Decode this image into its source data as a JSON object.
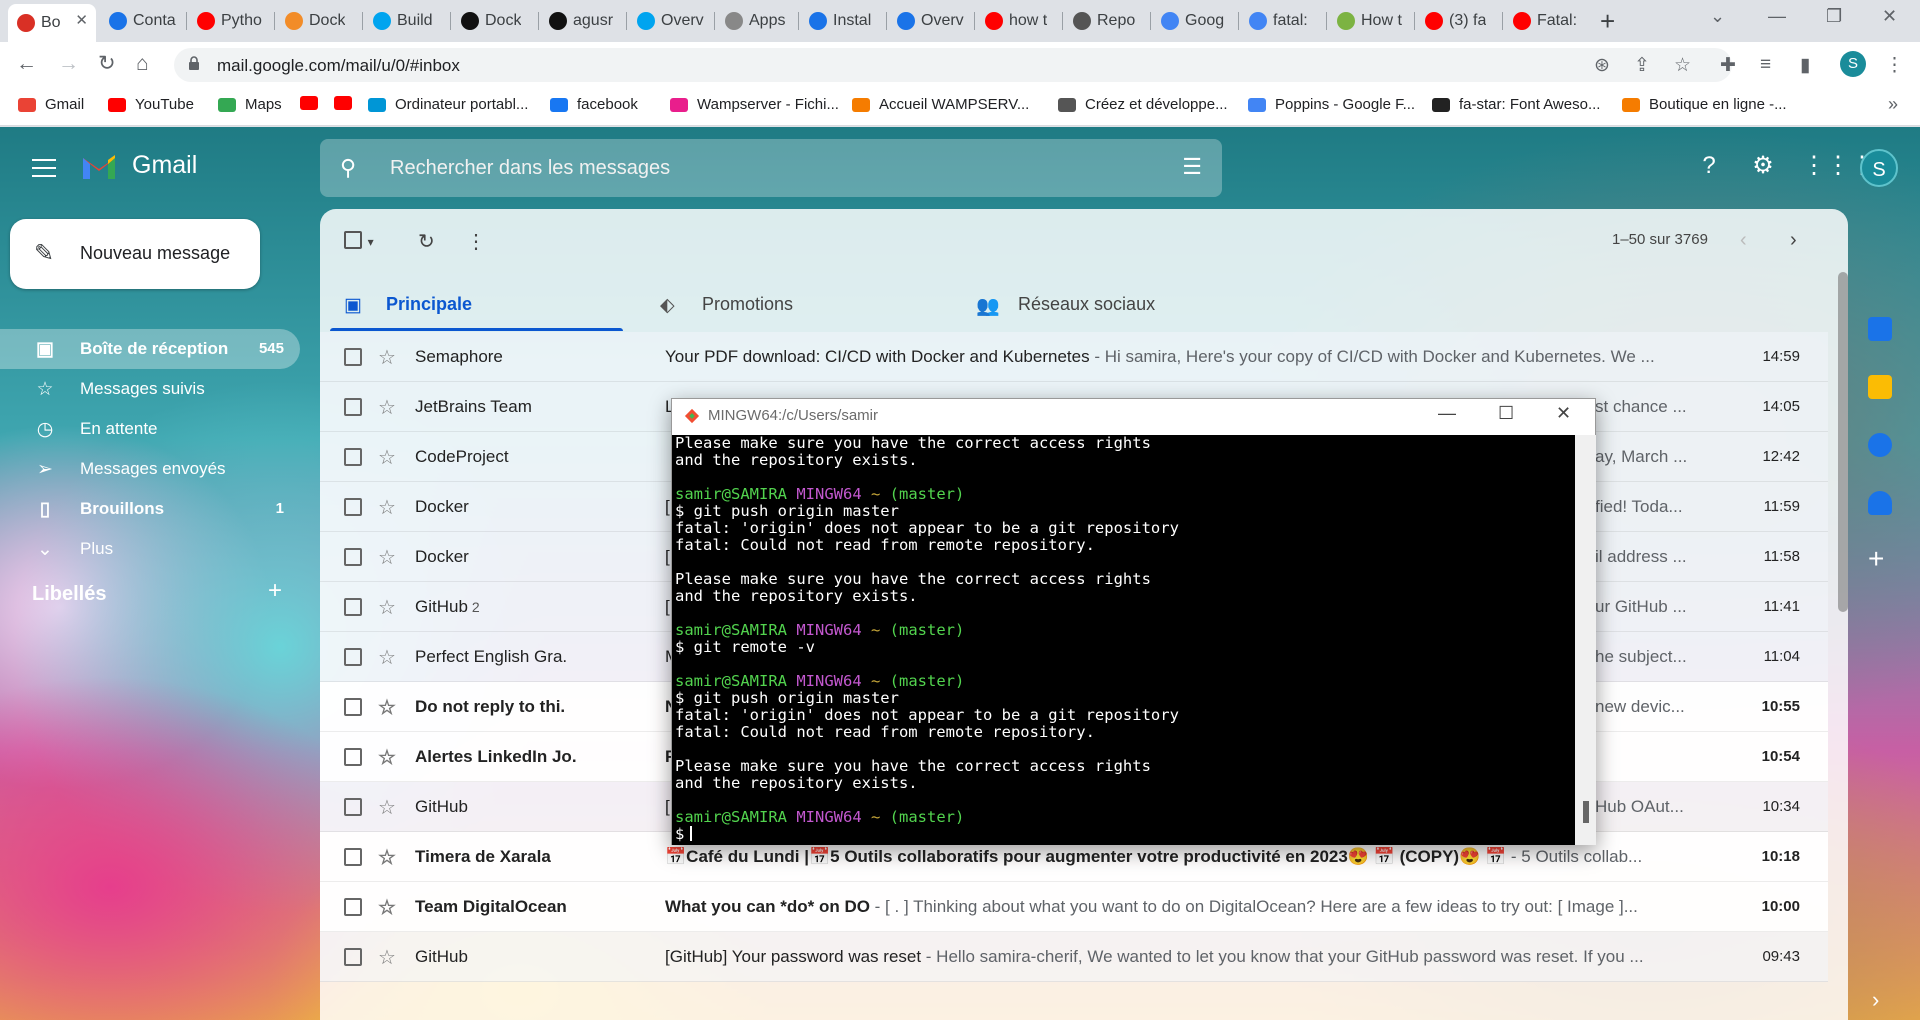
{
  "tabs": [
    {
      "title": "Bo",
      "fav": "#d93025",
      "active": true
    },
    {
      "title": "Conta",
      "fav": "#1a73e8"
    },
    {
      "title": "Pytho",
      "fav": "#ff0000"
    },
    {
      "title": "Dock",
      "fav": "#f28c28"
    },
    {
      "title": "Build",
      "fav": "#00a4ef"
    },
    {
      "title": "Dock",
      "fav": "#111111"
    },
    {
      "title": "agusr",
      "fav": "#111111"
    },
    {
      "title": "Overv",
      "fav": "#00a4ef"
    },
    {
      "title": "Apps",
      "fav": "#888888"
    },
    {
      "title": "Instal",
      "fav": "#1a73e8"
    },
    {
      "title": "Overv",
      "fav": "#1a73e8"
    },
    {
      "title": "how t",
      "fav": "#ff0000"
    },
    {
      "title": "Repo",
      "fav": "#555555"
    },
    {
      "title": "Goog",
      "fav": "#4285f4"
    },
    {
      "title": "fatal:",
      "fav": "#4285f4"
    },
    {
      "title": "How t",
      "fav": "#7cb342"
    },
    {
      "title": "(3) fa",
      "fav": "#ff0000"
    },
    {
      "title": "Fatal:",
      "fav": "#ff0000"
    }
  ],
  "browser": {
    "url": "mail.google.com/mail/u/0/#inbox",
    "profile_initial": "S"
  },
  "bookmarks": [
    {
      "label": "Gmail",
      "color": "#ea4335"
    },
    {
      "label": "YouTube",
      "color": "#ff0000"
    },
    {
      "label": "Maps",
      "color": "#34a853"
    },
    {
      "label": "",
      "color": "#ff0000"
    },
    {
      "label": "",
      "color": "#ff0000"
    },
    {
      "label": "Ordinateur portabl...",
      "color": "#0096d6"
    },
    {
      "label": "facebook",
      "color": "#1877f2"
    },
    {
      "label": "Wampserver - Fichi...",
      "color": "#e91e8c"
    },
    {
      "label": "Accueil WAMPSERV...",
      "color": "#f57c00"
    },
    {
      "label": "Créez et développe...",
      "color": "#555555"
    },
    {
      "label": "Poppins - Google F...",
      "color": "#4285f4"
    },
    {
      "label": "fa-star: Font Aweso...",
      "color": "#222222"
    },
    {
      "label": "Boutique en ligne -...",
      "color": "#f57c00"
    }
  ],
  "gmail": {
    "app_name": "Gmail",
    "search_placeholder": "Rechercher dans les messages",
    "avatar_initial": "S",
    "compose_label": "Nouveau message",
    "nav": [
      {
        "label": "Boîte de réception",
        "count": "545",
        "active": true,
        "icon": "inbox-icon",
        "glyph": "▣"
      },
      {
        "label": "Messages suivis",
        "count": "",
        "icon": "star-icon",
        "glyph": "☆"
      },
      {
        "label": "En attente",
        "count": "",
        "icon": "clock-icon",
        "glyph": "◷"
      },
      {
        "label": "Messages envoyés",
        "count": "",
        "icon": "send-icon",
        "glyph": "➢"
      },
      {
        "label": "Brouillons",
        "count": "1",
        "bold": true,
        "icon": "draft-icon",
        "glyph": "▯"
      },
      {
        "label": "Plus",
        "count": "",
        "icon": "chevron-down-icon",
        "glyph": "⌄"
      }
    ],
    "labels_title": "Libellés",
    "pager": "1–50 sur 3769",
    "categories": [
      {
        "label": "Principale",
        "icon": "inbox-tab-icon",
        "glyph": "▣",
        "active": true
      },
      {
        "label": "Promotions",
        "icon": "tag-icon",
        "glyph": "⬖"
      },
      {
        "label": "Réseaux sociaux",
        "icon": "people-icon",
        "glyph": "👥"
      }
    ],
    "emails": [
      {
        "sender": "Semaphore",
        "count": "",
        "subject": "Your PDF download: CI/CD with Docker and Kubernetes",
        "snippet": " - Hi samira, Here's your copy of CI/CD with Docker and Kubernetes. We ...",
        "time": "14:59",
        "unread": false
      },
      {
        "sender": "JetBrains Team",
        "count": "",
        "subject": "L",
        "snippet": "",
        "tail": "st chance ...",
        "time": "14:05",
        "unread": false
      },
      {
        "sender": "CodeProject",
        "count": "",
        "subject": "",
        "snippet": "",
        "tail": "ay, March ...",
        "time": "12:42",
        "unread": false
      },
      {
        "sender": "Docker",
        "count": "",
        "subject": "[",
        "snippet": "",
        "tail": "fied! Toda...",
        "time": "11:59",
        "unread": false
      },
      {
        "sender": "Docker",
        "count": "",
        "subject": "[",
        "snippet": "",
        "tail": "il address ...",
        "time": "11:58",
        "unread": false
      },
      {
        "sender": "GitHub",
        "count": "2",
        "subject": "[",
        "snippet": "",
        "tail": "ur GitHub ...",
        "time": "11:41",
        "unread": false
      },
      {
        "sender": "Perfect English Gra.",
        "count": "",
        "subject": "M",
        "snippet": "",
        "tail": "he subject...",
        "time": "11:04",
        "unread": false
      },
      {
        "sender": "Do not reply to thi.",
        "count": "",
        "subject": "N",
        "snippet": "",
        "tail": " new devic...",
        "time": "10:55",
        "unread": true
      },
      {
        "sender": "Alertes LinkedIn Jo.",
        "count": "",
        "subject": "F",
        "snippet": "",
        "tail": "",
        "time": "10:54",
        "unread": true
      },
      {
        "sender": "GitHub",
        "count": "",
        "subject": "[",
        "snippet": "",
        "tail": "Hub OAut...",
        "time": "10:34",
        "unread": false
      },
      {
        "sender": "Timera de Xarala",
        "count": "",
        "subject": "📅Café du Lundi |📅5 Outils collaboratifs pour augmenter votre productivité en 2023😍 📅 (COPY)😍 📅",
        "snippet": " - 5 Outils collab...",
        "time": "10:18",
        "unread": true
      },
      {
        "sender": "Team DigitalOcean",
        "count": "",
        "subject": "What you can *do* on DO",
        "snippet": " - [ . ] Thinking about what you want to do on DigitalOcean? Here are a few ideas to try out: [ Image ]...",
        "time": "10:00",
        "unread": true
      },
      {
        "sender": "GitHub",
        "count": "",
        "subject": "[GitHub] Your password was reset",
        "snippet": " - Hello samira-cherif, We wanted to let you know that your GitHub password was reset. If you ...",
        "time": "09:43",
        "unread": false
      }
    ]
  },
  "terminal": {
    "title": "MINGW64:/c/Users/samir",
    "lines": [
      [
        {
          "t": "Please make sure you have the correct access rights",
          "c": "w"
        }
      ],
      [
        {
          "t": "and the repository exists.",
          "c": "w"
        }
      ],
      [
        {
          "t": "",
          "c": "w"
        }
      ],
      [
        {
          "t": "samir@SAMIRA ",
          "c": "g"
        },
        {
          "t": "MINGW64 ",
          "c": "p"
        },
        {
          "t": "~ ",
          "c": "y"
        },
        {
          "t": "(master)",
          "c": "g"
        }
      ],
      [
        {
          "t": "$ git push origin master",
          "c": "w"
        }
      ],
      [
        {
          "t": "fatal: 'origin' does not appear to be a git repository",
          "c": "w"
        }
      ],
      [
        {
          "t": "fatal: Could not read from remote repository.",
          "c": "w"
        }
      ],
      [
        {
          "t": "",
          "c": "w"
        }
      ],
      [
        {
          "t": "Please make sure you have the correct access rights",
          "c": "w"
        }
      ],
      [
        {
          "t": "and the repository exists.",
          "c": "w"
        }
      ],
      [
        {
          "t": "",
          "c": "w"
        }
      ],
      [
        {
          "t": "samir@SAMIRA ",
          "c": "g"
        },
        {
          "t": "MINGW64 ",
          "c": "p"
        },
        {
          "t": "~ ",
          "c": "y"
        },
        {
          "t": "(master)",
          "c": "g"
        }
      ],
      [
        {
          "t": "$ git remote -v",
          "c": "w"
        }
      ],
      [
        {
          "t": "",
          "c": "w"
        }
      ],
      [
        {
          "t": "samir@SAMIRA ",
          "c": "g"
        },
        {
          "t": "MINGW64 ",
          "c": "p"
        },
        {
          "t": "~ ",
          "c": "y"
        },
        {
          "t": "(master)",
          "c": "g"
        }
      ],
      [
        {
          "t": "$ git push origin master",
          "c": "w"
        }
      ],
      [
        {
          "t": "fatal: 'origin' does not appear to be a git repository",
          "c": "w"
        }
      ],
      [
        {
          "t": "fatal: Could not read from remote repository.",
          "c": "w"
        }
      ],
      [
        {
          "t": "",
          "c": "w"
        }
      ],
      [
        {
          "t": "Please make sure you have the correct access rights",
          "c": "w"
        }
      ],
      [
        {
          "t": "and the repository exists.",
          "c": "w"
        }
      ],
      [
        {
          "t": "",
          "c": "w"
        }
      ],
      [
        {
          "t": "samir@SAMIRA ",
          "c": "g"
        },
        {
          "t": "MINGW64 ",
          "c": "p"
        },
        {
          "t": "~ ",
          "c": "y"
        },
        {
          "t": "(master)",
          "c": "g"
        }
      ],
      [
        {
          "t": "$",
          "c": "w"
        }
      ]
    ]
  }
}
